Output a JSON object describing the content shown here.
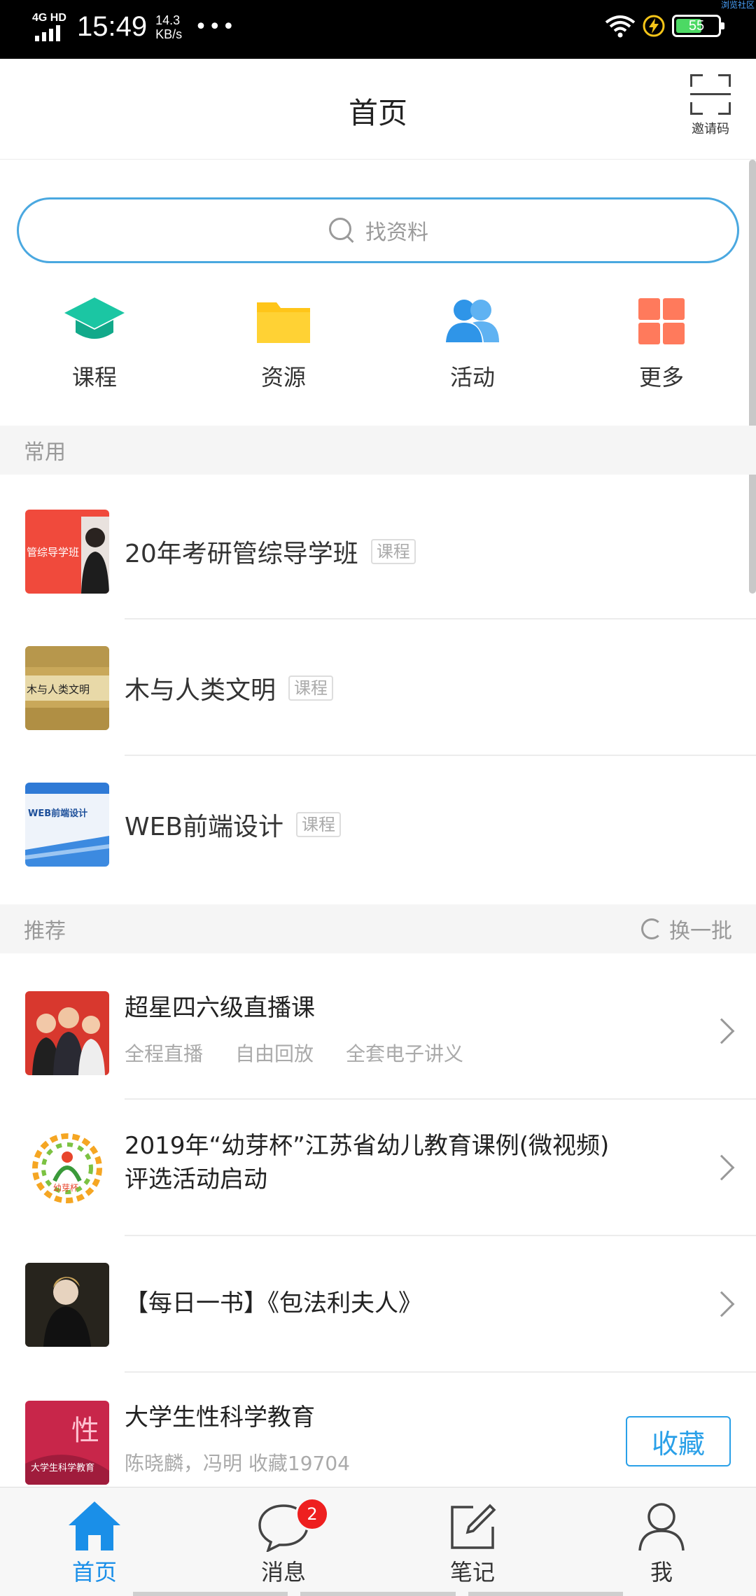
{
  "status_bar": {
    "network": "4G HD",
    "time": "15:49",
    "speed_value": "14.3",
    "speed_unit": "KB/s",
    "dots": "•••",
    "battery": "55",
    "corner_text": "浏览社区"
  },
  "header": {
    "title": "首页",
    "invite_label": "邀请码"
  },
  "search": {
    "placeholder": "找资料"
  },
  "quick_nav": [
    {
      "label": "课程",
      "icon": "graduation-cap-icon",
      "color": "#1bc6a3"
    },
    {
      "label": "资源",
      "icon": "folder-icon",
      "color": "#ffc519"
    },
    {
      "label": "活动",
      "icon": "users-icon",
      "color": "#2f95e8"
    },
    {
      "label": "更多",
      "icon": "grid-icon",
      "color": "#ff7a5c"
    }
  ],
  "common": {
    "section_title": "常用",
    "items": [
      {
        "title": "20年考研管综导学班",
        "tag": "课程"
      },
      {
        "title": "木与人类文明",
        "tag": "课程"
      },
      {
        "title": "WEB前端设计",
        "tag": "课程"
      }
    ]
  },
  "recommend": {
    "section_title": "推荐",
    "refresh_label": "换一批",
    "items": [
      {
        "title": "超星四六级直播课",
        "tags": [
          "全程直播",
          "自由回放",
          "全套电子讲义"
        ]
      },
      {
        "title": "2019年“幼芽杯”江苏省幼儿教育课例(微视频)评选活动启动"
      },
      {
        "title": "【每日一书】《包法利夫人》"
      },
      {
        "title": "大学生性科学教育",
        "subtitle": "陈晓麟，冯明 收藏19704",
        "action": "收藏"
      }
    ]
  },
  "thumbs": {
    "kaoyan_text": "管综导学班",
    "wood_text": "木与人类文明",
    "web_text": "WEB前端设计",
    "edu_logo_text": "幼芽杯",
    "book_text": "大学生科学教育",
    "book_big_char": "性"
  },
  "tabbar": [
    {
      "label": "首页",
      "icon": "home-icon",
      "active": true
    },
    {
      "label": "消息",
      "icon": "chat-bubble-icon",
      "badge": "2"
    },
    {
      "label": "笔记",
      "icon": "edit-note-icon"
    },
    {
      "label": "我",
      "icon": "person-icon"
    }
  ],
  "colors": {
    "accent": "#1a8fe8",
    "search_border": "#4aa8e0",
    "badge": "#ee1f1f"
  }
}
